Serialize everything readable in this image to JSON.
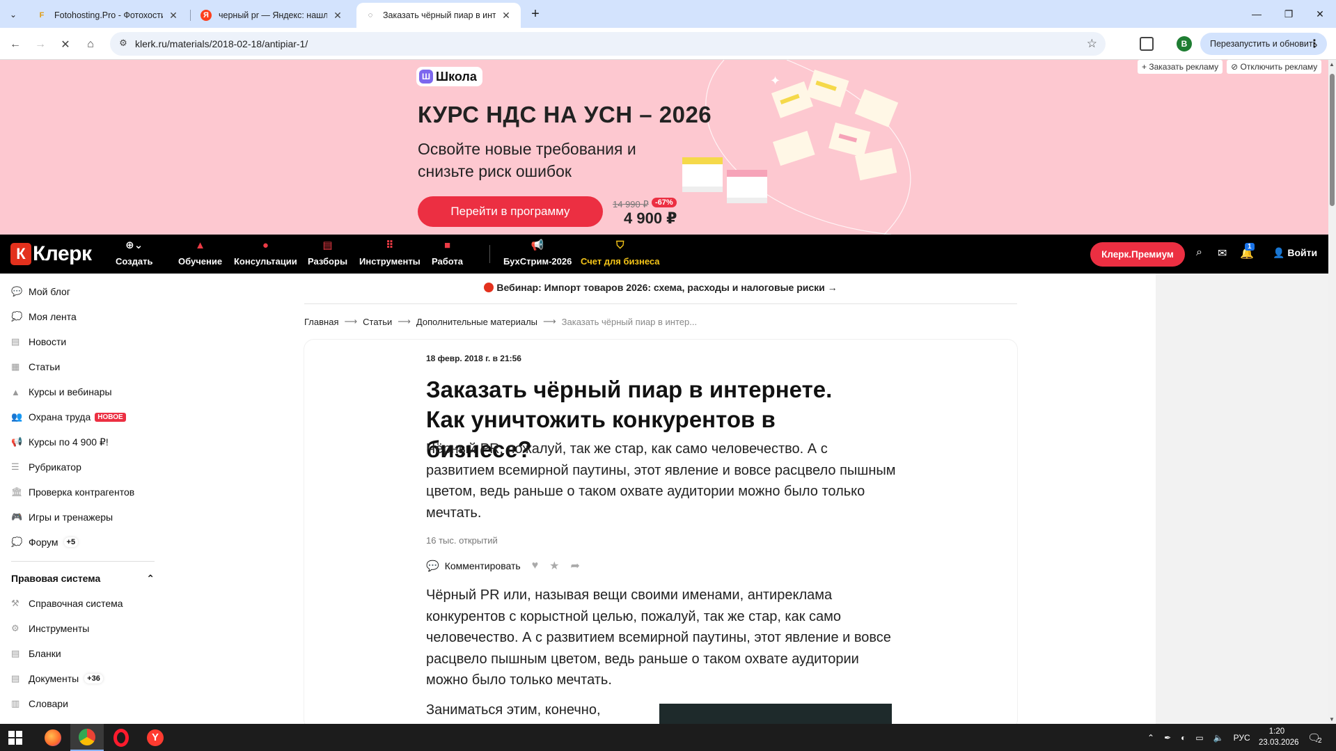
{
  "browser": {
    "tabs": [
      {
        "title": "Fotohosting.Pro - Фотохостинг",
        "favicon": "fotohosting-icon"
      },
      {
        "title": "черный pr — Яндекс: нашлось",
        "favicon": "yandex-icon"
      },
      {
        "title": "Заказать чёрный пиар в интерн",
        "favicon": "klerk-icon"
      }
    ],
    "url": "klerk.ru/materials/2018-02-18/antipiar-1/",
    "profile_initial": "B",
    "relaunch_label": "Перезапустить и обновить"
  },
  "ad": {
    "order_ad": "Заказать рекламу",
    "disable_ad": "Отключить рекламу",
    "school_label": "Школа",
    "title": "КУРС НДС НА УСН – 2026",
    "subtitle": "Освойте новые требования и снизьте риск ошибок",
    "cta": "Перейти в программу",
    "old_price": "14 990 ₽",
    "discount": "-67%",
    "price": "4 900 ₽"
  },
  "site": {
    "logo": "Клерк",
    "nav": [
      {
        "label": "Создать",
        "icon": "plus-icon"
      },
      {
        "label": "Обучение",
        "icon": "graduation-icon"
      },
      {
        "label": "Консультации",
        "icon": "question-icon"
      },
      {
        "label": "Разборы",
        "icon": "news-icon"
      },
      {
        "label": "Инструменты",
        "icon": "grid-icon"
      },
      {
        "label": "Работа",
        "icon": "briefcase-icon"
      },
      {
        "label": "БухСтрим-2026",
        "icon": "megaphone-icon"
      },
      {
        "label": "Счет для бизнеса",
        "icon": "shield-icon"
      }
    ],
    "premium": "Клерк.Премиум",
    "notifications": "1",
    "login": "Войти"
  },
  "sidebar": {
    "items": [
      {
        "label": "Мой блог"
      },
      {
        "label": "Моя лента"
      },
      {
        "label": "Новости"
      },
      {
        "label": "Статьи"
      },
      {
        "label": "Курсы и вебинары"
      },
      {
        "label": "Охрана труда",
        "badge": "НОВОЕ"
      },
      {
        "label": "Курсы по 4 900 ₽!"
      },
      {
        "label": "Рубрикатор"
      },
      {
        "label": "Проверка контрагентов"
      },
      {
        "label": "Игры и тренажеры"
      },
      {
        "label": "Форум",
        "count": "+5"
      }
    ],
    "section_title": "Правовая система",
    "section_items": [
      {
        "label": "Справочная система"
      },
      {
        "label": "Инструменты"
      },
      {
        "label": "Бланки"
      },
      {
        "label": "Документы",
        "count": "+36"
      },
      {
        "label": "Словари"
      }
    ]
  },
  "webinar": "Вебинар: Импорт товаров 2026: схема, расходы и налоговые риски →",
  "breadcrumbs": [
    "Главная",
    "Статьи",
    "Дополнительные материалы",
    "Заказать чёрный пиар в интер..."
  ],
  "article": {
    "date": "18 февр. 2018 г. в 21:56",
    "title": "Заказать чёрный пиар в интернете. Как уничтожить конкурентов в бизнесе?",
    "lead": "Чёрный PR, пожалуй, так же стар, как само человечество. А с развитием всемирной паутины, этот явление и вовсе расцвело пышным цветом, ведь раньше о таком охвате аудитории можно было только мечтать.",
    "views": "16 тыс. открытий",
    "comment_label": "Комментировать",
    "body": "Чёрный PR или, называя вещи своими именами, антиреклама конкурентов с корыстной целью, пожалуй, так же стар, как само человечество. А с развитием всемирной паутины, этот явление и вовсе расцвело пышным цветом, ведь раньше о таком охвате аудитории можно было только мечтать.",
    "body2": "Заниматься этим, конечно,"
  },
  "taskbar": {
    "lang": "РУС",
    "time": "1:20",
    "date": "23.03.2026",
    "notif_count": "2"
  }
}
